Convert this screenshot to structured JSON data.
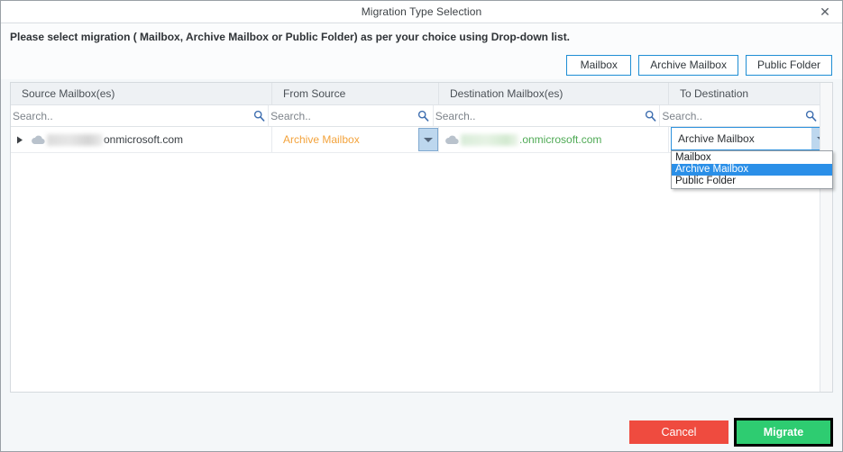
{
  "window": {
    "title": "Migration Type Selection",
    "close_label": "✕"
  },
  "instruction": {
    "text": "Please select migration ( Mailbox, Archive Mailbox or Public Folder) as per your choice using Drop-down list."
  },
  "type_buttons": [
    {
      "label": "Mailbox"
    },
    {
      "label": "Archive Mailbox"
    },
    {
      "label": "Public Folder"
    }
  ],
  "grid": {
    "columns": [
      {
        "header": "Source Mailbox(es)",
        "search_placeholder": "Search.."
      },
      {
        "header": "From Source",
        "search_placeholder": "Search.."
      },
      {
        "header": "Destination Mailbox(es)",
        "search_placeholder": "Search.."
      },
      {
        "header": "To Destination",
        "search_placeholder": "Search.."
      }
    ],
    "rows": [
      {
        "source_mailbox_suffix": "onmicrosoft.com",
        "from_source_value": "Archive Mailbox",
        "destination_mailbox_suffix": ".onmicrosoft.com",
        "to_destination_value": "Archive Mailbox"
      }
    ]
  },
  "dropdown": {
    "open": true,
    "options": [
      "Mailbox",
      "Archive Mailbox",
      "Public Folder"
    ],
    "selected": "Archive Mailbox"
  },
  "footer": {
    "cancel_label": "Cancel",
    "migrate_label": "Migrate"
  },
  "colors": {
    "accent_blue": "#2f93dd",
    "from_source_text": "#f3a33c",
    "destination_text": "#4faa55",
    "cancel_red": "#ef4b3f",
    "migrate_green": "#2ecc71",
    "dropdown_highlight": "#2a8fe8"
  }
}
